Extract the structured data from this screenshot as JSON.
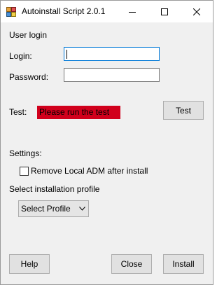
{
  "window": {
    "title": "Autoinstall Script 2.0.1",
    "app_icon": "app-window-icon",
    "controls": [
      "minimize-icon",
      "maximize-icon",
      "close-icon"
    ]
  },
  "login_section": {
    "heading": "User login",
    "login_label": "Login:",
    "login_value": "",
    "password_label": "Password:",
    "password_value": ""
  },
  "test_section": {
    "label": "Test:",
    "status_text": "Please run the test",
    "status_color": "#d1001c",
    "test_button": "Test"
  },
  "settings": {
    "heading": "Settings:",
    "remove_adm_label": "Remove Local ADM after install",
    "remove_adm_checked": false,
    "profile_label": "Select installation profile",
    "profile_selected": "Select Profile"
  },
  "footer": {
    "help_button": "Help",
    "close_button": "Close",
    "install_button": "Install"
  }
}
